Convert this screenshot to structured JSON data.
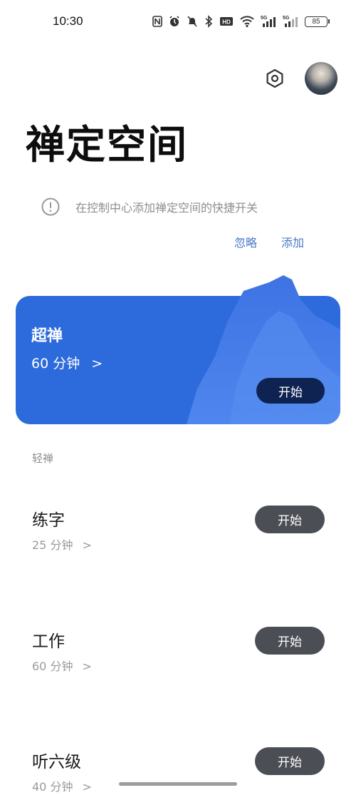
{
  "status": {
    "time": "10:30",
    "battery": "85",
    "signal_1": "5G",
    "signal_2": "5G"
  },
  "header": {
    "title": "禅定空间"
  },
  "hint": {
    "text": "在控制中心添加禅定空间的快捷开关",
    "ignore": "忽略",
    "add": "添加"
  },
  "hero": {
    "title": "超禅",
    "duration": "60 分钟",
    "chevron": ">",
    "start": "开始"
  },
  "section": {
    "label": "轻禅"
  },
  "items": [
    {
      "title": "练字",
      "duration": "25 分钟",
      "chevron": ">",
      "start": "开始"
    },
    {
      "title": "工作",
      "duration": "60 分钟",
      "chevron": ">",
      "start": "开始"
    },
    {
      "title": "听六级",
      "duration": "40 分钟",
      "chevron": ">",
      "start": "开始"
    }
  ],
  "colors": {
    "accent": "#2d6bdc",
    "hero_button": "#0e2352",
    "item_button": "#4c4e55",
    "link": "#4a77c6"
  }
}
